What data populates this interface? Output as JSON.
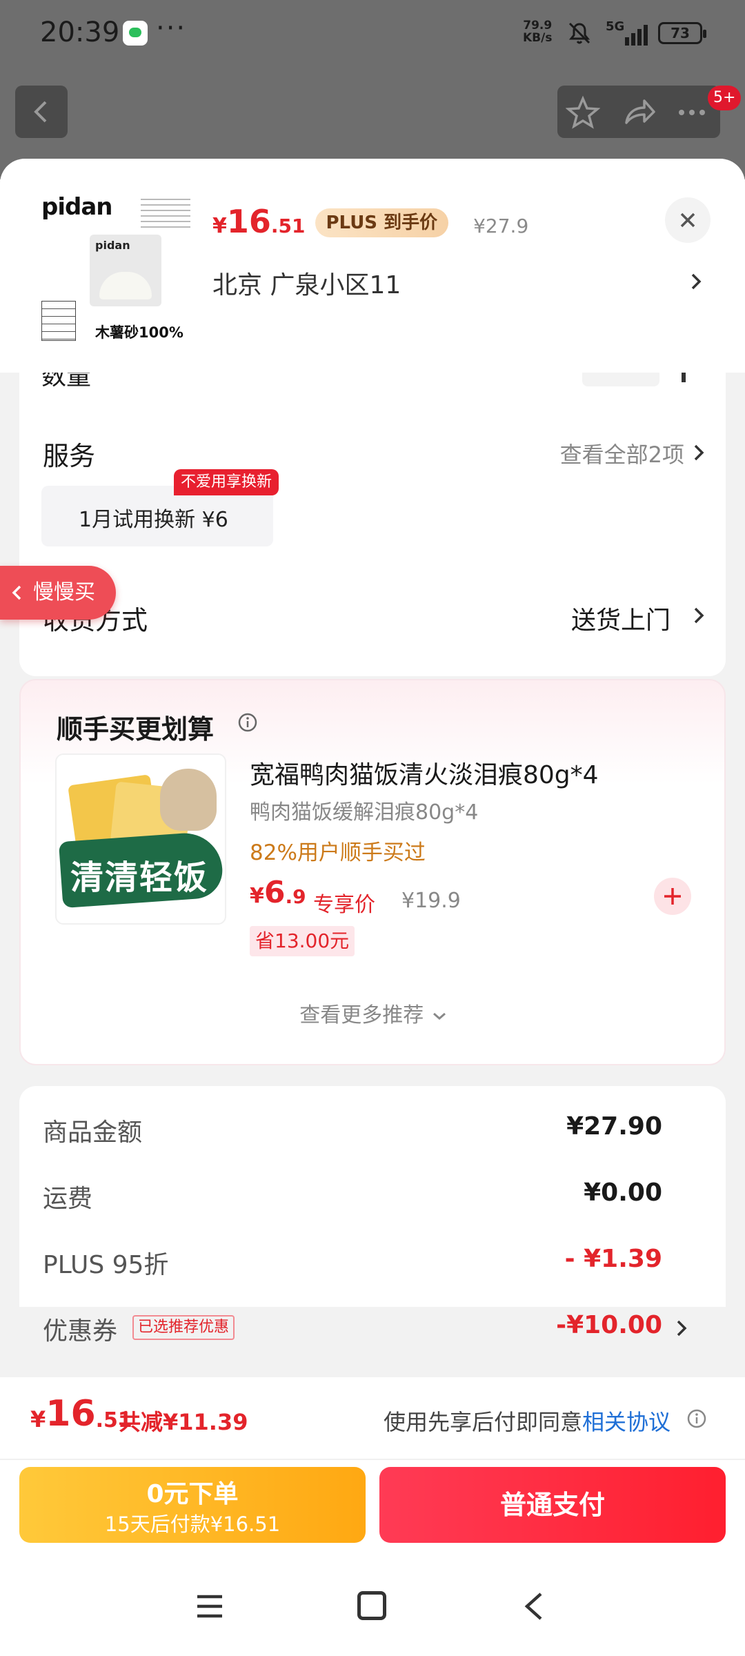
{
  "status_bar": {
    "time": "20:39",
    "dots": "···",
    "speed_value": "79.9",
    "speed_unit": "KB/s",
    "network": "5G",
    "battery": "73"
  },
  "nav": {
    "badge": "5+"
  },
  "product": {
    "thumb_brand": "pidan",
    "thumb_caption": "木薯砂100%",
    "price_currency": "¥",
    "price_int": "16",
    "price_dec": ".51",
    "plus_tag": "PLUS 到手价",
    "original_price": "¥27.9",
    "address": "北京  广泉小区11"
  },
  "quantity": {
    "label": "数量"
  },
  "service": {
    "title": "服务",
    "view_all": "查看全部2项",
    "option_label": "1月试用换新  ¥6",
    "option_badge": "不爱用享换新"
  },
  "delivery": {
    "title": "收货方式",
    "value": "送货上门"
  },
  "slow_buy": {
    "label": "慢慢买"
  },
  "recommendation": {
    "title": "顺手买更划算",
    "item": {
      "name": "宽福鸭肉猫饭清火淡泪痕80g*4",
      "subtitle": "鸭肉猫饭缓解泪痕80g*4",
      "stat": "82%用户顺手买过",
      "price_currency": "¥",
      "price_int": "6",
      "price_dec": ".9",
      "price_label": "专享价",
      "original_price": "¥19.9",
      "save": "省13.00元",
      "image_text": "清清轻饭"
    },
    "more": "查看更多推荐"
  },
  "summary": {
    "rows": [
      {
        "label": "商品金额",
        "value": "¥27.90"
      },
      {
        "label": "运费",
        "value": "¥0.00"
      },
      {
        "label": "PLUS 95折",
        "value": "- ¥1.39"
      },
      {
        "label": "优惠券",
        "tag": "已选推荐优惠",
        "value": "-¥10.00"
      }
    ]
  },
  "bottom": {
    "total_currency": "¥",
    "total_int": "16",
    "total_dec": ".51",
    "total_saved": "共减¥11.39",
    "agree_prefix": "使用先享后付即同意",
    "agree_link": "相关协议",
    "later_main": "0元下单",
    "later_sub": "15天后付款¥16.51",
    "pay_label": "普通支付"
  },
  "colors": {
    "accent_red": "#e3242b",
    "pay_button": "#ff2a3d",
    "later_button": "#ffb521",
    "link_blue": "#1f6fd6"
  }
}
